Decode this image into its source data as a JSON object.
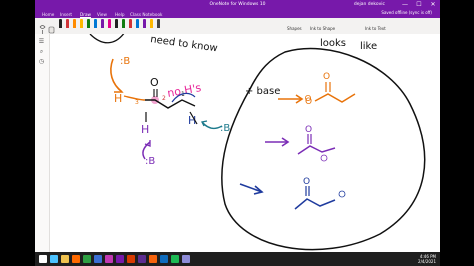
{
  "window": {
    "title": "OneNote for Windows 10",
    "user": "dejan dekovic",
    "minimize_glyph": "—",
    "maximize_glyph": "☐",
    "close_glyph": "✕"
  },
  "menu": {
    "items": [
      "Home",
      "Insert",
      "Draw",
      "View",
      "Help",
      "Class Notebook"
    ],
    "active": "Draw",
    "sync_notice_line1": "Saved offline (sync is off)",
    "sync_notice_line2": "Share"
  },
  "ribbon": {
    "pen_colors": [
      "#222222",
      "#d13438",
      "#ff8c00",
      "#ffb900",
      "#107c10",
      "#0078d4",
      "#7719aa",
      "#e3008c",
      "#222222",
      "#107c10",
      "#d13438",
      "#0078d4",
      "#7719aa",
      "#ffb900",
      "#444444"
    ],
    "shapes_label": "Shapes",
    "ink_to_shape_label": "Ink to Shape",
    "ink_to_text_label": "Ink to Text"
  },
  "canvas": {
    "top_text": "need to know",
    "right_text_line1": "looks",
    "right_text_line2": "like",
    "base_label_1": ":B",
    "base_label_2": ":B",
    "base_label_3": ":B",
    "h_label": "H",
    "h_label_2": "H",
    "h_label_3": "H",
    "o_label": "O",
    "no_h_label": "no H's",
    "plus_base": "+ base",
    "num_3": "3",
    "num_2": "2",
    "num_1": "1"
  },
  "taskbar": {
    "time": "4:46 PM",
    "date": "2/4/2021",
    "icon_colors": [
      "#ffffff",
      "#4cc2ff",
      "#f0c24f",
      "#ff6a00",
      "#2ea043",
      "#3b6fd4",
      "#c239b3",
      "#7719aa",
      "#d83b01",
      "#5c2d91",
      "#f7630c",
      "#0f6cbd",
      "#1db954",
      "#8e8cd8"
    ]
  },
  "colors": {
    "onenote_purple": "#7719aa",
    "ink_orange": "#e8730a",
    "ink_pink": "#e8299a",
    "ink_purple": "#7b2db6",
    "ink_blue": "#1f3b9e",
    "ink_teal": "#1d7a8c",
    "ink_black": "#111111"
  }
}
